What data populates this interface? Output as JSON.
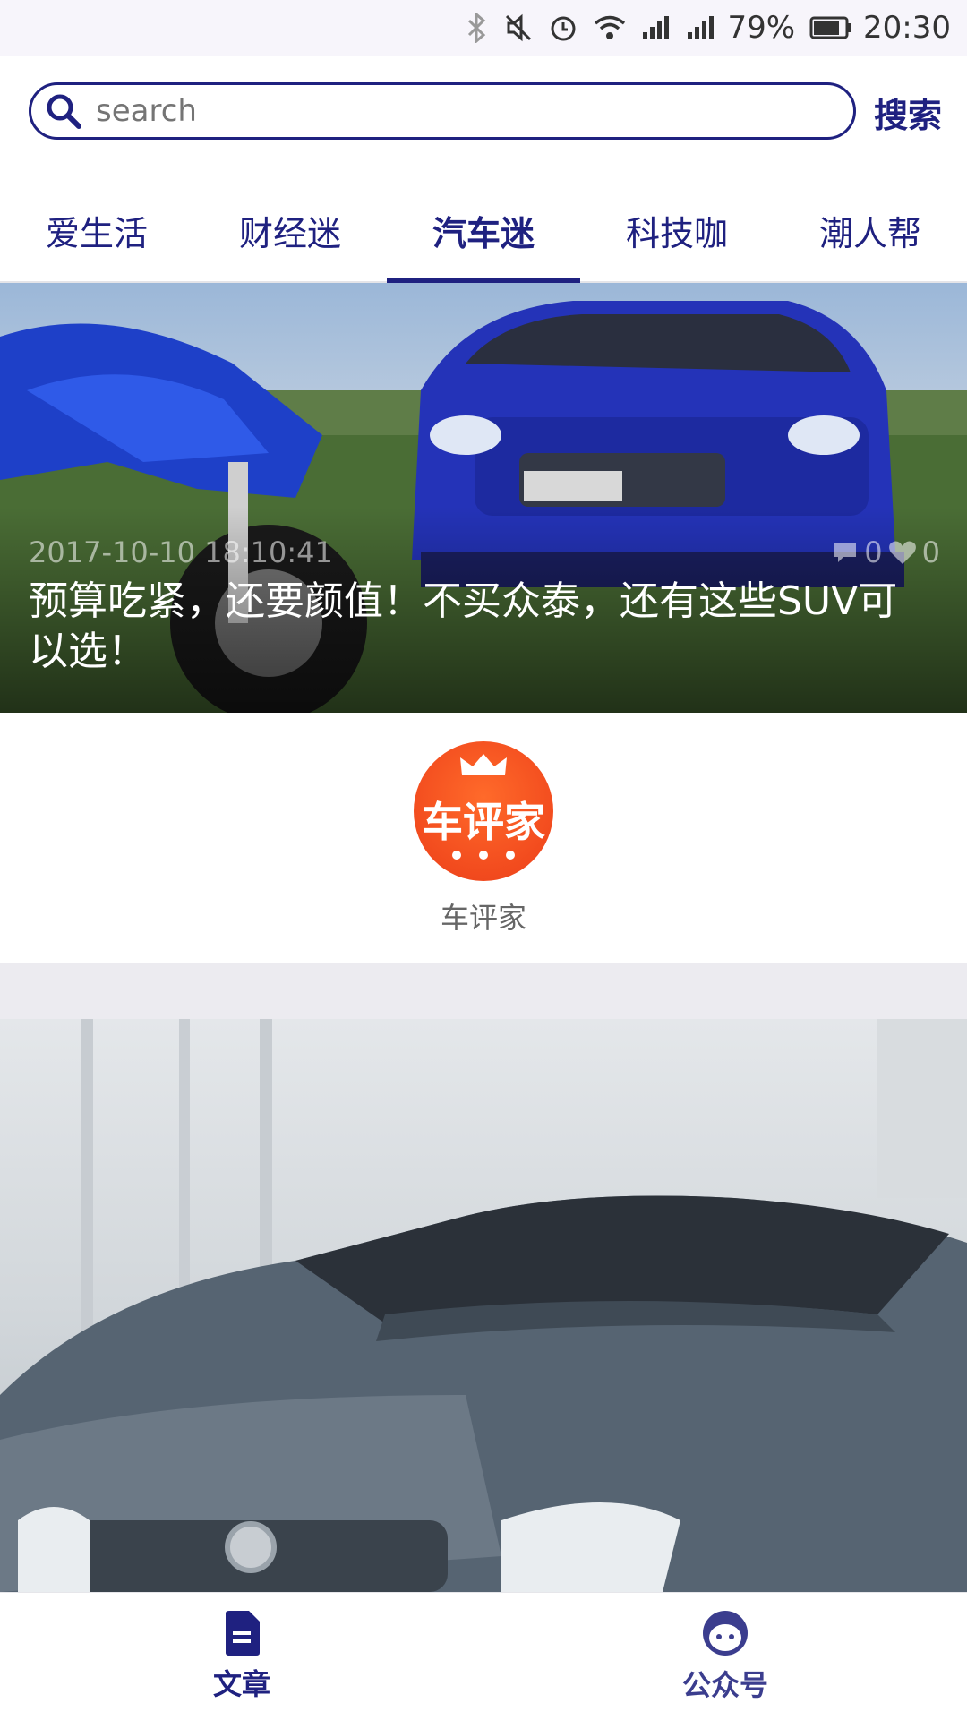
{
  "status_bar": {
    "icons": [
      "bluetooth-icon",
      "mute-icon",
      "alarm-icon",
      "wifi-icon",
      "signal-icon",
      "signal-icon",
      "battery-icon"
    ],
    "battery": "79%",
    "time": "20:30"
  },
  "search": {
    "placeholder": "search",
    "button_label": "搜索"
  },
  "tabs": [
    {
      "label": "爱生活"
    },
    {
      "label": "财经迷"
    },
    {
      "label": "汽车迷",
      "active": true
    },
    {
      "label": "科技咖"
    },
    {
      "label": "潮人帮"
    }
  ],
  "hero": {
    "date": "2017-10-10 18:10:41",
    "comment_count": "0",
    "like_count": "0",
    "title": "预算吃紧，还要颜值！不买众泰，还有这些SUV可以选！"
  },
  "account": {
    "logo_text": "车评家",
    "name": "车评家"
  },
  "bottom_nav": {
    "articles_label": "文章",
    "accounts_label": "公众号"
  },
  "colors": {
    "accent": "#1f2180",
    "logo": "#f24b1e"
  }
}
